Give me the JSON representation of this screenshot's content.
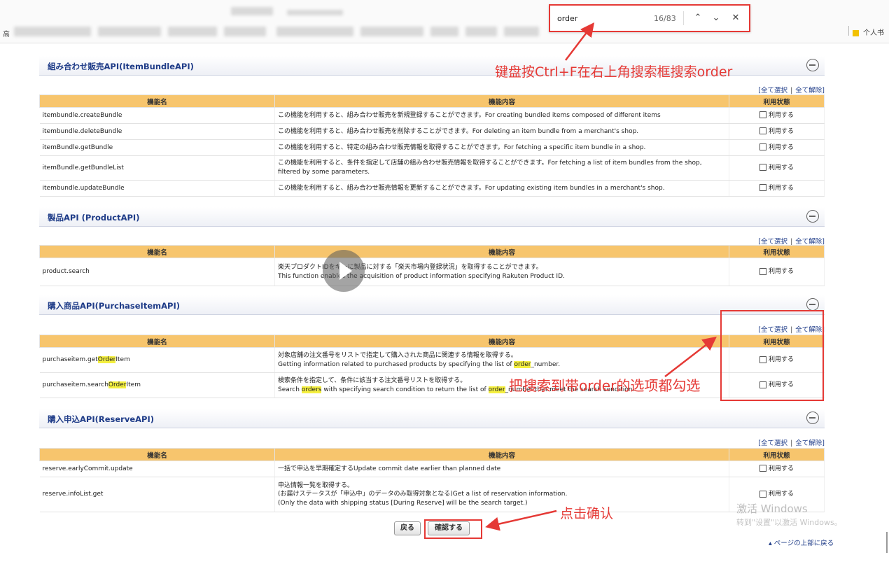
{
  "browser": {
    "bookmark_left": "高",
    "bookmark_right": "个人书"
  },
  "findbar": {
    "query": "order",
    "count": "16/83",
    "prev_icon": "chevron-up-icon",
    "next_icon": "chevron-down-icon",
    "close_icon": "close-icon"
  },
  "common": {
    "col_name": "機能名",
    "col_desc": "機能内容",
    "col_state": "利用状態",
    "select_all": "全て選択",
    "clear_all": "全て解除",
    "use_label": "利用する"
  },
  "sections": {
    "bundle": {
      "title": "組み合わせ販売API(ItemBundleAPI)",
      "rows": [
        {
          "name": "itembundle.createBundle",
          "desc": "この機能を利用すると、組み合わせ販売を新規登録することができます。For creating bundled items composed of different items"
        },
        {
          "name": "itembundle.deleteBundle",
          "desc": "この機能を利用すると、組み合わせ販売を削除することができます。For deleting an item bundle from a merchant's shop."
        },
        {
          "name": "itemBundle.getBundle",
          "desc": "この機能を利用すると、特定の組み合わせ販売情報を取得することができます。For fetching a specific item bundle in a shop."
        },
        {
          "name": "itemBundle.getBundleList",
          "desc": "この機能を利用すると、条件を指定して店舗の組み合わせ販売情報を取得することができます。For fetching a list of item bundles from the shop, filtered by some parameters."
        },
        {
          "name": "itembundle.updateBundle",
          "desc": "この機能を利用すると、組み合わせ販売情報を更新することができます。For updating existing item bundles in a merchant's shop."
        }
      ]
    },
    "product": {
      "title": "製品API (ProductAPI)",
      "rows": [
        {
          "name": "product.search",
          "desc1": "楽天プロダクトIDをキーに製品に対する「楽天市場内登録状況」を取得することができます。",
          "desc2": "This function enables the acquisition of product information specifying Rakuten Product ID."
        }
      ]
    },
    "purchase": {
      "title": "購入商品API(PurchaseItemAPI)",
      "rows": [
        {
          "name_pre": "purchaseitem.get",
          "name_hl": "Order",
          "name_post": "Item",
          "desc1": "対象店舗の注文番号をリストで指定して購入された商品に関連する情報を取得する。",
          "desc2_pre": "Getting information related to purchased products by specifying the list of ",
          "desc2_hl": "order",
          "desc2_post": "_number."
        },
        {
          "name_pre": "purchaseitem.search",
          "name_hl": "Order",
          "name_post": "Item",
          "desc1": "検索条件を指定して、条件に該当する注文番号リストを取得する。",
          "desc2_a": "Search ",
          "desc2_hl1": "orders",
          "desc2_b": " with specifying search condition to return the list of ",
          "desc2_hl2": "order",
          "desc2_c": "_number that meet the search condition."
        }
      ]
    },
    "reserve": {
      "title": "購入申込API(ReserveAPI)",
      "rows": [
        {
          "name": "reserve.earlyCommit.update",
          "desc": "一括で申込を早期確定するUpdate commit date earlier than planned date"
        },
        {
          "name": "reserve.infoList.get",
          "desc1": "申込情報一覧を取得する。",
          "desc2": "(お届けステータスが「申込中」のデータのみ取得対象となる)Get a list of reservation information.",
          "desc3": "(Only the data with shipping status [During Reserve] will be the search target.)"
        }
      ]
    }
  },
  "buttons": {
    "back": "戻る",
    "confirm": "確認する"
  },
  "annotations": {
    "search_tip": "键盘按Ctrl+F在右上角搜索框搜索order",
    "check_tip": "把搜索到带order的选项都勾选",
    "confirm_tip": "点击确认",
    "color": "#e53935"
  },
  "watermark": {
    "line1": "激活 Windows",
    "line2": "转到\"设置\"以激活 Windows。"
  },
  "page_top": "ページの上部に戻る"
}
